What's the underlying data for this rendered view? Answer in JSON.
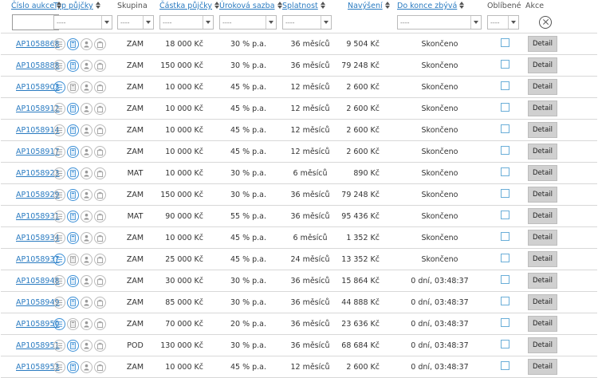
{
  "header": {
    "cislo": "Číslo aukce",
    "typ": "Typ půjčky",
    "skupina": "Skupina",
    "castka": "Částka půjčky",
    "sazba": "Úroková sazba",
    "splatnost": "Splatnost",
    "navyseni": "Navýšení",
    "dokonce": "Do konce zbývá",
    "oblibene": "Oblíbené",
    "akce": "Akce"
  },
  "filters": {
    "select_placeholder": "----"
  },
  "detail_label": "Detail",
  "rows": [
    {
      "id": "AP1058868",
      "types": [
        0,
        1,
        0,
        0
      ],
      "skupina": "ZAM",
      "castka": "18 000 Kč",
      "sazba": "30 % p.a.",
      "splatnost": "36 měsíců",
      "navyseni": "9 504 Kč",
      "zbyva": "Skončeno"
    },
    {
      "id": "AP1058888",
      "types": [
        0,
        1,
        0,
        0
      ],
      "skupina": "ZAM",
      "castka": "150 000 Kč",
      "sazba": "30 % p.a.",
      "splatnost": "36 měsíců",
      "navyseni": "79 248 Kč",
      "zbyva": "Skončeno"
    },
    {
      "id": "AP1058903",
      "types": [
        1,
        0,
        0,
        0
      ],
      "skupina": "ZAM",
      "castka": "10 000 Kč",
      "sazba": "45 % p.a.",
      "splatnost": "12 měsíců",
      "navyseni": "2 600 Kč",
      "zbyva": "Skončeno"
    },
    {
      "id": "AP1058912",
      "types": [
        0,
        1,
        0,
        0
      ],
      "skupina": "ZAM",
      "castka": "10 000 Kč",
      "sazba": "45 % p.a.",
      "splatnost": "12 měsíců",
      "navyseni": "2 600 Kč",
      "zbyva": "Skončeno"
    },
    {
      "id": "AP1058914",
      "types": [
        0,
        1,
        0,
        0
      ],
      "skupina": "ZAM",
      "castka": "10 000 Kč",
      "sazba": "45 % p.a.",
      "splatnost": "12 měsíců",
      "navyseni": "2 600 Kč",
      "zbyva": "Skončeno"
    },
    {
      "id": "AP1058917",
      "types": [
        0,
        1,
        0,
        0
      ],
      "skupina": "ZAM",
      "castka": "10 000 Kč",
      "sazba": "45 % p.a.",
      "splatnost": "12 měsíců",
      "navyseni": "2 600 Kč",
      "zbyva": "Skončeno"
    },
    {
      "id": "AP1058923",
      "types": [
        0,
        1,
        0,
        0
      ],
      "skupina": "MAT",
      "castka": "10 000 Kč",
      "sazba": "30 % p.a.",
      "splatnost": "6 měsíců",
      "navyseni": "890 Kč",
      "zbyva": "Skončeno"
    },
    {
      "id": "AP1058929",
      "types": [
        0,
        1,
        0,
        0
      ],
      "skupina": "ZAM",
      "castka": "150 000 Kč",
      "sazba": "30 % p.a.",
      "splatnost": "36 měsíců",
      "navyseni": "79 248 Kč",
      "zbyva": "Skončeno"
    },
    {
      "id": "AP1058931",
      "types": [
        0,
        1,
        0,
        0
      ],
      "skupina": "MAT",
      "castka": "90 000 Kč",
      "sazba": "55 % p.a.",
      "splatnost": "36 měsíců",
      "navyseni": "95 436 Kč",
      "zbyva": "Skončeno"
    },
    {
      "id": "AP1058934",
      "types": [
        0,
        1,
        0,
        0
      ],
      "skupina": "ZAM",
      "castka": "10 000 Kč",
      "sazba": "45 % p.a.",
      "splatnost": "6 měsíců",
      "navyseni": "1 352 Kč",
      "zbyva": "Skončeno"
    },
    {
      "id": "AP1058937",
      "types": [
        1,
        0,
        0,
        0
      ],
      "skupina": "ZAM",
      "castka": "25 000 Kč",
      "sazba": "45 % p.a.",
      "splatnost": "24 měsíců",
      "navyseni": "13 352 Kč",
      "zbyva": "Skončeno"
    },
    {
      "id": "AP1058948",
      "types": [
        0,
        1,
        0,
        0
      ],
      "skupina": "ZAM",
      "castka": "30 000 Kč",
      "sazba": "30 % p.a.",
      "splatnost": "36 měsíců",
      "navyseni": "15 864 Kč",
      "zbyva": "0 dní, 03:48:37"
    },
    {
      "id": "AP1058949",
      "types": [
        0,
        1,
        0,
        0
      ],
      "skupina": "ZAM",
      "castka": "85 000 Kč",
      "sazba": "30 % p.a.",
      "splatnost": "36 měsíců",
      "navyseni": "44 888 Kč",
      "zbyva": "0 dní, 03:48:37"
    },
    {
      "id": "AP1058950",
      "types": [
        1,
        0,
        0,
        0
      ],
      "skupina": "ZAM",
      "castka": "70 000 Kč",
      "sazba": "20 % p.a.",
      "splatnost": "36 měsíců",
      "navyseni": "23 636 Kč",
      "zbyva": "0 dní, 03:48:37"
    },
    {
      "id": "AP1058951",
      "types": [
        0,
        1,
        0,
        0
      ],
      "skupina": "POD",
      "castka": "130 000 Kč",
      "sazba": "30 % p.a.",
      "splatnost": "36 měsíců",
      "navyseni": "68 684 Kč",
      "zbyva": "0 dní, 03:48:37"
    },
    {
      "id": "AP1058953",
      "types": [
        0,
        1,
        0,
        0
      ],
      "skupina": "ZAM",
      "castka": "10 000 Kč",
      "sazba": "45 % p.a.",
      "splatnost": "12 měsíců",
      "navyseni": "2 600 Kč",
      "zbyva": "0 dní, 03:48:37"
    }
  ]
}
